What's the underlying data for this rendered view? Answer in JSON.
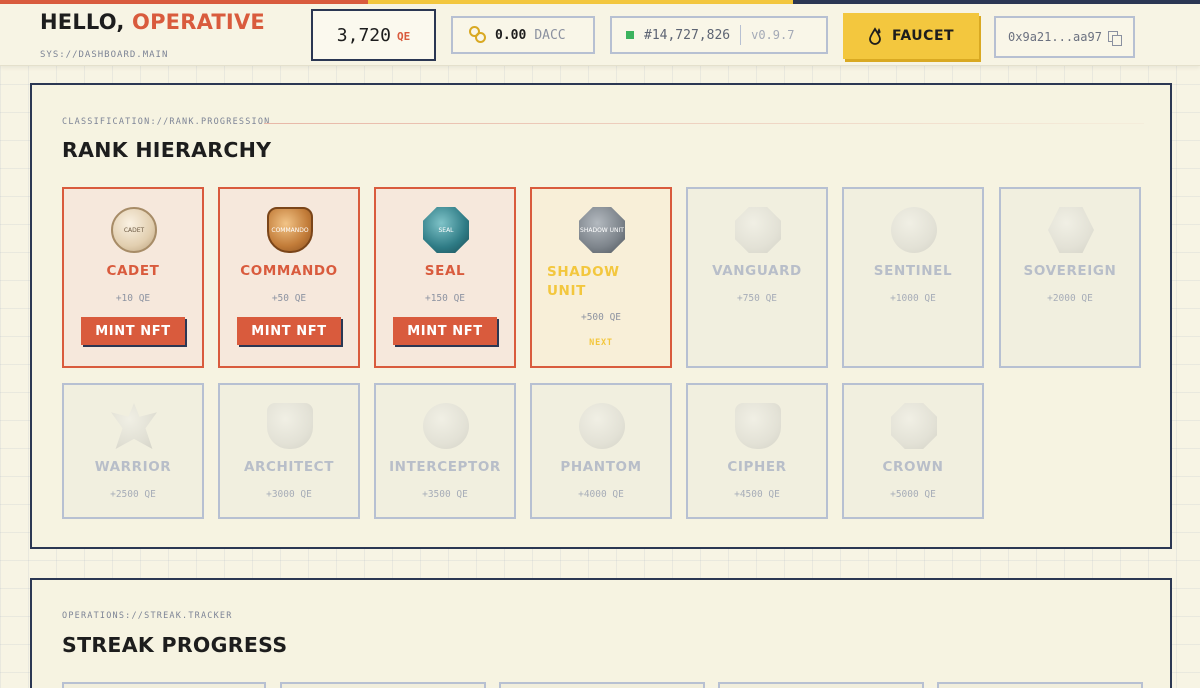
{
  "header": {
    "greeting": "HELLO,",
    "name": "OPERATIVE",
    "syspath": "SYS://DASHBOARD.MAIN",
    "points": "3,720",
    "points_unit": "QE",
    "dacc_value": "0.00",
    "dacc_unit": "DACC",
    "block": "#14,727,826",
    "version": "v0.9.7",
    "faucet_label": "FAUCET",
    "wallet": "0x9a21...aa97"
  },
  "colors": {
    "accent_orange": "#d95b3d",
    "accent_yellow": "#f3c73e",
    "navy": "#2b3753",
    "status_green": "#3cb35e"
  },
  "rank": {
    "classification": "CLASSIFICATION://RANK.PROGRESSION",
    "title": "RANK HIERARCHY",
    "mint_label": "MINT NFT",
    "next_label": "NEXT",
    "items": [
      {
        "name": "CADET",
        "points": "+10 QE",
        "badge_text": "CADET",
        "state": "minted",
        "icon": "cadet-badge-icon"
      },
      {
        "name": "COMMANDO",
        "points": "+50 QE",
        "badge_text": "COMMANDO",
        "state": "minted",
        "icon": "commando-badge-icon"
      },
      {
        "name": "SEAL",
        "points": "+150 QE",
        "badge_text": "SEAL",
        "state": "minted",
        "icon": "seal-badge-icon"
      },
      {
        "name": "SHADOW UNIT",
        "points": "+500 QE",
        "badge_text": "SHADOW UNIT",
        "state": "next",
        "icon": "shadow-unit-badge-icon"
      },
      {
        "name": "VANGUARD",
        "points": "+750 QE",
        "state": "locked",
        "icon": "vanguard-badge-icon"
      },
      {
        "name": "SENTINEL",
        "points": "+1000 QE",
        "state": "locked",
        "icon": "sentinel-badge-icon"
      },
      {
        "name": "SOVEREIGN",
        "points": "+2000 QE",
        "state": "locked",
        "icon": "sovereign-badge-icon"
      },
      {
        "name": "WARRIOR",
        "points": "+2500 QE",
        "state": "locked",
        "icon": "warrior-badge-icon"
      },
      {
        "name": "ARCHITECT",
        "points": "+3000 QE",
        "state": "locked",
        "icon": "architect-badge-icon"
      },
      {
        "name": "INTERCEPTOR",
        "points": "+3500 QE",
        "state": "locked",
        "icon": "interceptor-badge-icon"
      },
      {
        "name": "PHANTOM",
        "points": "+4000 QE",
        "state": "locked",
        "icon": "phantom-badge-icon"
      },
      {
        "name": "CIPHER",
        "points": "+4500 QE",
        "state": "locked",
        "icon": "cipher-badge-icon"
      },
      {
        "name": "CROWN",
        "points": "+5000 QE",
        "state": "locked",
        "icon": "crown-badge-icon"
      }
    ]
  },
  "streak": {
    "classification": "OPERATIONS://STREAK.TRACKER",
    "title": "STREAK PROGRESS"
  }
}
